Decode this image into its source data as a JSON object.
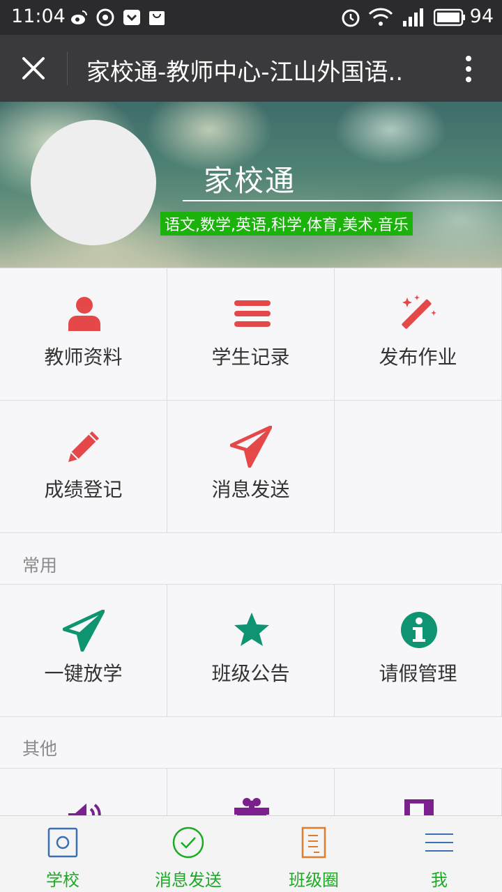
{
  "status_bar": {
    "time": "11:04",
    "battery": "94"
  },
  "title_bar": {
    "title": "家校通-教师中心-江山外国语.."
  },
  "banner": {
    "brand": "家校通",
    "subjects": "语文,数学,英语,科学,体育,美术,音乐"
  },
  "main_grid": {
    "items": [
      {
        "label": "教师资料",
        "icon": "user-icon"
      },
      {
        "label": "学生记录",
        "icon": "list-icon"
      },
      {
        "label": "发布作业",
        "icon": "magic-wand-icon"
      },
      {
        "label": "成绩登记",
        "icon": "pencil-icon"
      },
      {
        "label": "消息发送",
        "icon": "paper-plane-icon"
      }
    ]
  },
  "common_section": {
    "label": "常用",
    "items": [
      {
        "label": "一键放学",
        "icon": "paper-plane-icon"
      },
      {
        "label": "班级公告",
        "icon": "star-icon"
      },
      {
        "label": "请假管理",
        "icon": "info-icon"
      }
    ]
  },
  "other_section": {
    "label": "其他"
  },
  "tab_bar": {
    "items": [
      {
        "label": "学校",
        "icon": "school-icon"
      },
      {
        "label": "消息发送",
        "icon": "check-circle-icon"
      },
      {
        "label": "班级圈",
        "icon": "document-icon"
      },
      {
        "label": "我",
        "icon": "menu-icon"
      }
    ]
  },
  "colors": {
    "red_accent": "#e54848",
    "teal_accent": "#0e9470",
    "purple_accent": "#7b1f8e",
    "tab_green": "#1aab23",
    "subjects_bg": "#1bb20c"
  }
}
